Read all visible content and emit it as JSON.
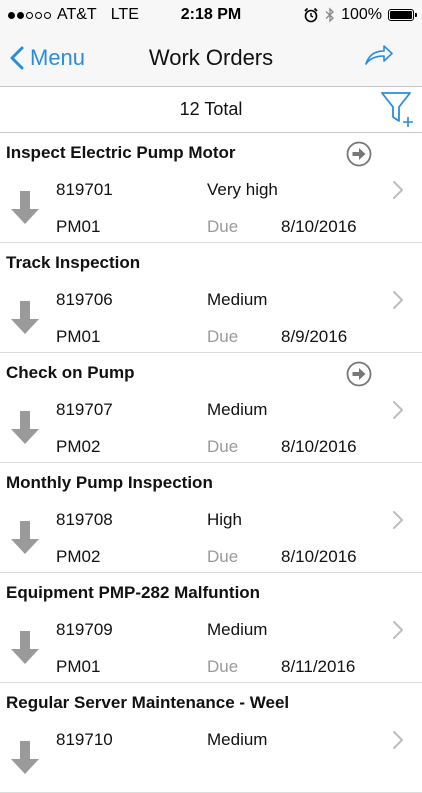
{
  "status_bar": {
    "carrier": "AT&T",
    "network": "LTE",
    "time": "2:18 PM",
    "battery": "100%",
    "battery_level": 1.0,
    "signal_bars": 2
  },
  "nav": {
    "back_label": "Menu",
    "title": "Work Orders"
  },
  "summary": {
    "total_label": "12 Total"
  },
  "colors": {
    "accent": "#2a8ddc",
    "muted": "#9a9a9a",
    "separator": "#dcdcdc"
  },
  "work_orders": [
    {
      "title": "Inspect Electric Pump Motor",
      "number": "819701",
      "priority": "Very high",
      "type": "PM01",
      "due_label": "Due",
      "due_date": "8/10/2016",
      "has_go_icon": true
    },
    {
      "title": "Track Inspection",
      "number": "819706",
      "priority": "Medium",
      "type": "PM01",
      "due_label": "Due",
      "due_date": "8/9/2016",
      "has_go_icon": false
    },
    {
      "title": "Check on Pump",
      "number": "819707",
      "priority": "Medium",
      "type": "PM02",
      "due_label": "Due",
      "due_date": "8/10/2016",
      "has_go_icon": true
    },
    {
      "title": "Monthly Pump Inspection",
      "number": "819708",
      "priority": "High",
      "type": "PM02",
      "due_label": "Due",
      "due_date": "8/10/2016",
      "has_go_icon": false
    },
    {
      "title": "Equipment PMP-282 Malfuntion",
      "number": "819709",
      "priority": "Medium",
      "type": "PM01",
      "due_label": "Due",
      "due_date": "8/11/2016",
      "has_go_icon": false
    },
    {
      "title": "Regular Server Maintenance - Weel",
      "number": "819710",
      "priority": "Medium",
      "type": "",
      "due_label": "",
      "due_date": "",
      "has_go_icon": false
    }
  ],
  "icons": {
    "back": "chevron-left-icon",
    "share": "share-arrow-icon",
    "filter": "filter-add-icon",
    "go": "circle-arrow-right-icon",
    "row_status": "down-arrow-icon",
    "disclosure": "chevron-right-icon"
  }
}
